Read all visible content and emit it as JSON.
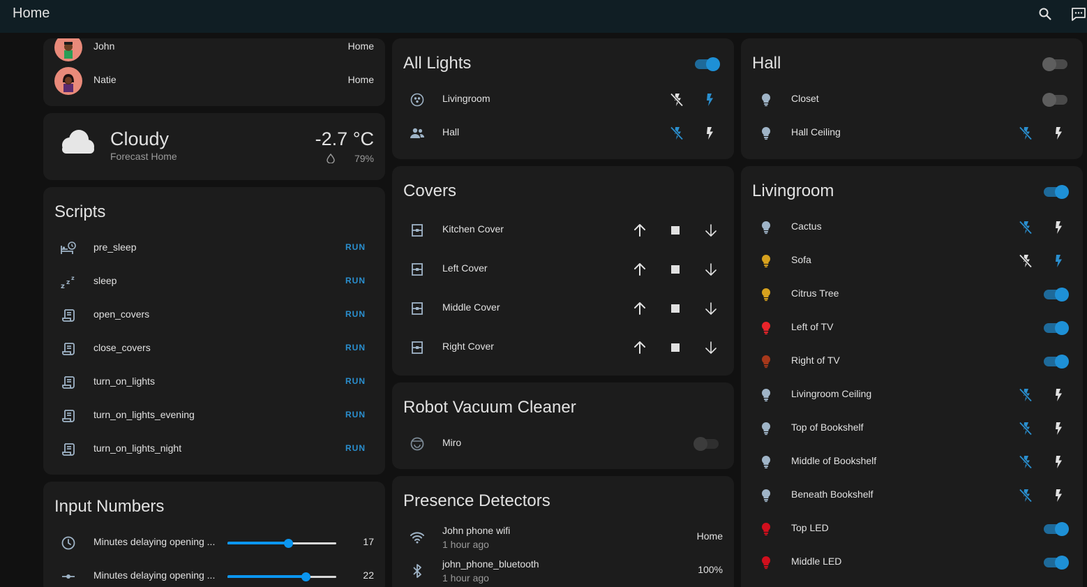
{
  "header": {
    "title": "Home"
  },
  "people": [
    {
      "name": "John",
      "state": "Home"
    },
    {
      "name": "Natie",
      "state": "Home"
    }
  ],
  "weather": {
    "condition": "Cloudy",
    "subtitle": "Forecast Home",
    "temperature": "-2.7 °C",
    "humidity": "79%"
  },
  "scripts": {
    "title": "Scripts",
    "run_label": "RUN",
    "items": [
      {
        "name": "pre_sleep",
        "icon": "bed-clock-icon"
      },
      {
        "name": "sleep",
        "icon": "sleep-icon"
      },
      {
        "name": "open_covers",
        "icon": "script-icon"
      },
      {
        "name": "close_covers",
        "icon": "script-icon"
      },
      {
        "name": "turn_on_lights",
        "icon": "script-icon"
      },
      {
        "name": "turn_on_lights_evening",
        "icon": "script-icon"
      },
      {
        "name": "turn_on_lights_night",
        "icon": "script-icon"
      }
    ]
  },
  "input_numbers": {
    "title": "Input Numbers",
    "items": [
      {
        "name": "Minutes delaying opening ...",
        "value": "17",
        "fraction": 0.56
      },
      {
        "name": "Minutes delaying opening ...",
        "value": "22",
        "fraction": 0.72
      }
    ]
  },
  "all_lights": {
    "title": "All Lights",
    "master_on": true,
    "items": [
      {
        "name": "Livingroom",
        "icon": "group-icon",
        "flash_active": "on"
      },
      {
        "name": "Hall",
        "icon": "account-group-icon",
        "flash_active": "off"
      }
    ]
  },
  "covers": {
    "title": "Covers",
    "items": [
      {
        "name": "Kitchen Cover"
      },
      {
        "name": "Left Cover"
      },
      {
        "name": "Middle Cover"
      },
      {
        "name": "Right Cover"
      }
    ]
  },
  "vacuum": {
    "title": "Robot Vacuum Cleaner",
    "items": [
      {
        "name": "Miro",
        "state": "unavailable"
      }
    ]
  },
  "presence": {
    "title": "Presence Detectors",
    "items": [
      {
        "name": "John phone wifi",
        "time": "1 hour ago",
        "state": "Home",
        "icon": "wifi-icon"
      },
      {
        "name": "john_phone_bluetooth",
        "time": "1 hour ago",
        "state": "100%",
        "icon": "bluetooth-icon"
      }
    ]
  },
  "hall": {
    "title": "Hall",
    "master_on": false,
    "items": [
      {
        "name": "Closet",
        "type": "toggle",
        "on": false,
        "bulb": "#9fb4c7"
      },
      {
        "name": "Hall Ceiling",
        "type": "flash",
        "flash_active": "off",
        "bulb": "#9fb4c7"
      }
    ]
  },
  "livingroom": {
    "title": "Livingroom",
    "master_on": true,
    "items": [
      {
        "name": "Cactus",
        "type": "flash",
        "flash_active": "off",
        "bulb": "#9fb4c7"
      },
      {
        "name": "Sofa",
        "type": "flash",
        "flash_active": "on",
        "bulb": "#d6a11e"
      },
      {
        "name": "Citrus Tree",
        "type": "toggle",
        "on": true,
        "bulb": "#d6a11e"
      },
      {
        "name": "Left of TV",
        "type": "toggle",
        "on": true,
        "bulb": "#e8242a"
      },
      {
        "name": "Right of TV",
        "type": "toggle",
        "on": true,
        "bulb": "#a6381b"
      },
      {
        "name": "Livingroom Ceiling",
        "type": "flash",
        "flash_active": "off",
        "bulb": "#9fb4c7"
      },
      {
        "name": "Top of Bookshelf",
        "type": "flash",
        "flash_active": "off",
        "bulb": "#9fb4c7"
      },
      {
        "name": "Middle of Bookshelf",
        "type": "flash",
        "flash_active": "off",
        "bulb": "#9fb4c7"
      },
      {
        "name": "Beneath Bookshelf",
        "type": "flash",
        "flash_active": "off",
        "bulb": "#9fb4c7"
      },
      {
        "name": "Top LED",
        "type": "toggle",
        "on": true,
        "bulb": "#d10f1d"
      },
      {
        "name": "Middle LED",
        "type": "toggle",
        "on": true,
        "bulb": "#d10f1d"
      }
    ]
  },
  "colors": {
    "accent": "#2a8fcf",
    "toggle_on": "#1e90d6",
    "card": "#1c1c1c",
    "background": "#111111",
    "header": "#101e24",
    "icon": "#9fb4c7"
  }
}
